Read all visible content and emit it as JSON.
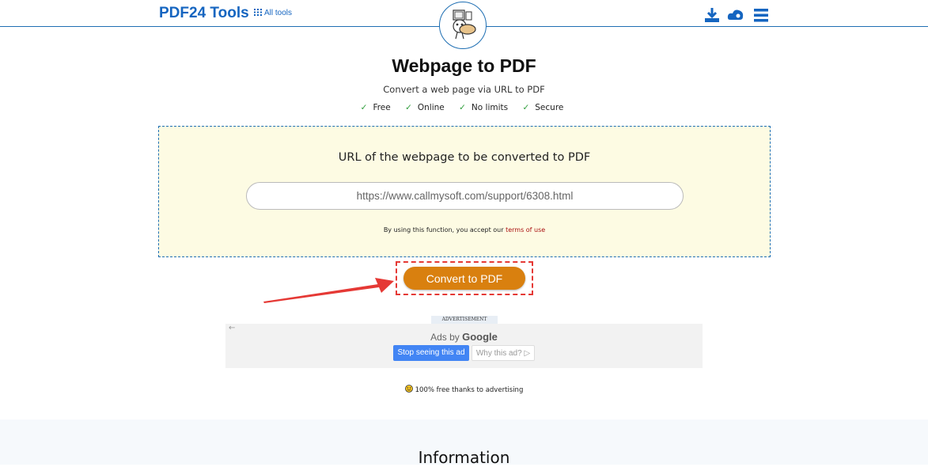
{
  "header": {
    "logo": "PDF24 Tools",
    "all_tools": "All tools",
    "icons": [
      "download-icon",
      "cloud-icon",
      "menu-icon"
    ]
  },
  "main": {
    "title": "Webpage to PDF",
    "subtitle": "Convert a web page via URL to PDF",
    "features": [
      "Free",
      "Online",
      "No limits",
      "Secure"
    ]
  },
  "form": {
    "label": "URL of the webpage to be converted to PDF",
    "url_value": "https://www.callmysoft.com/support/6308.html",
    "terms_prefix": "By using this function, you accept our",
    "terms_link": "terms of use",
    "convert_label": "Convert to PDF"
  },
  "ad": {
    "label": "ADVERTISEMENT",
    "ads_by": "Ads by",
    "google": "Google",
    "stop": "Stop seeing this ad",
    "why": "Why this ad? ▷"
  },
  "free_note": "100% free thanks to advertising",
  "info_title": "Information",
  "colors": {
    "brand": "#1565c0",
    "accent": "#d9800f",
    "highlight": "#e53935",
    "panel_bg": "#fdfbe3"
  }
}
